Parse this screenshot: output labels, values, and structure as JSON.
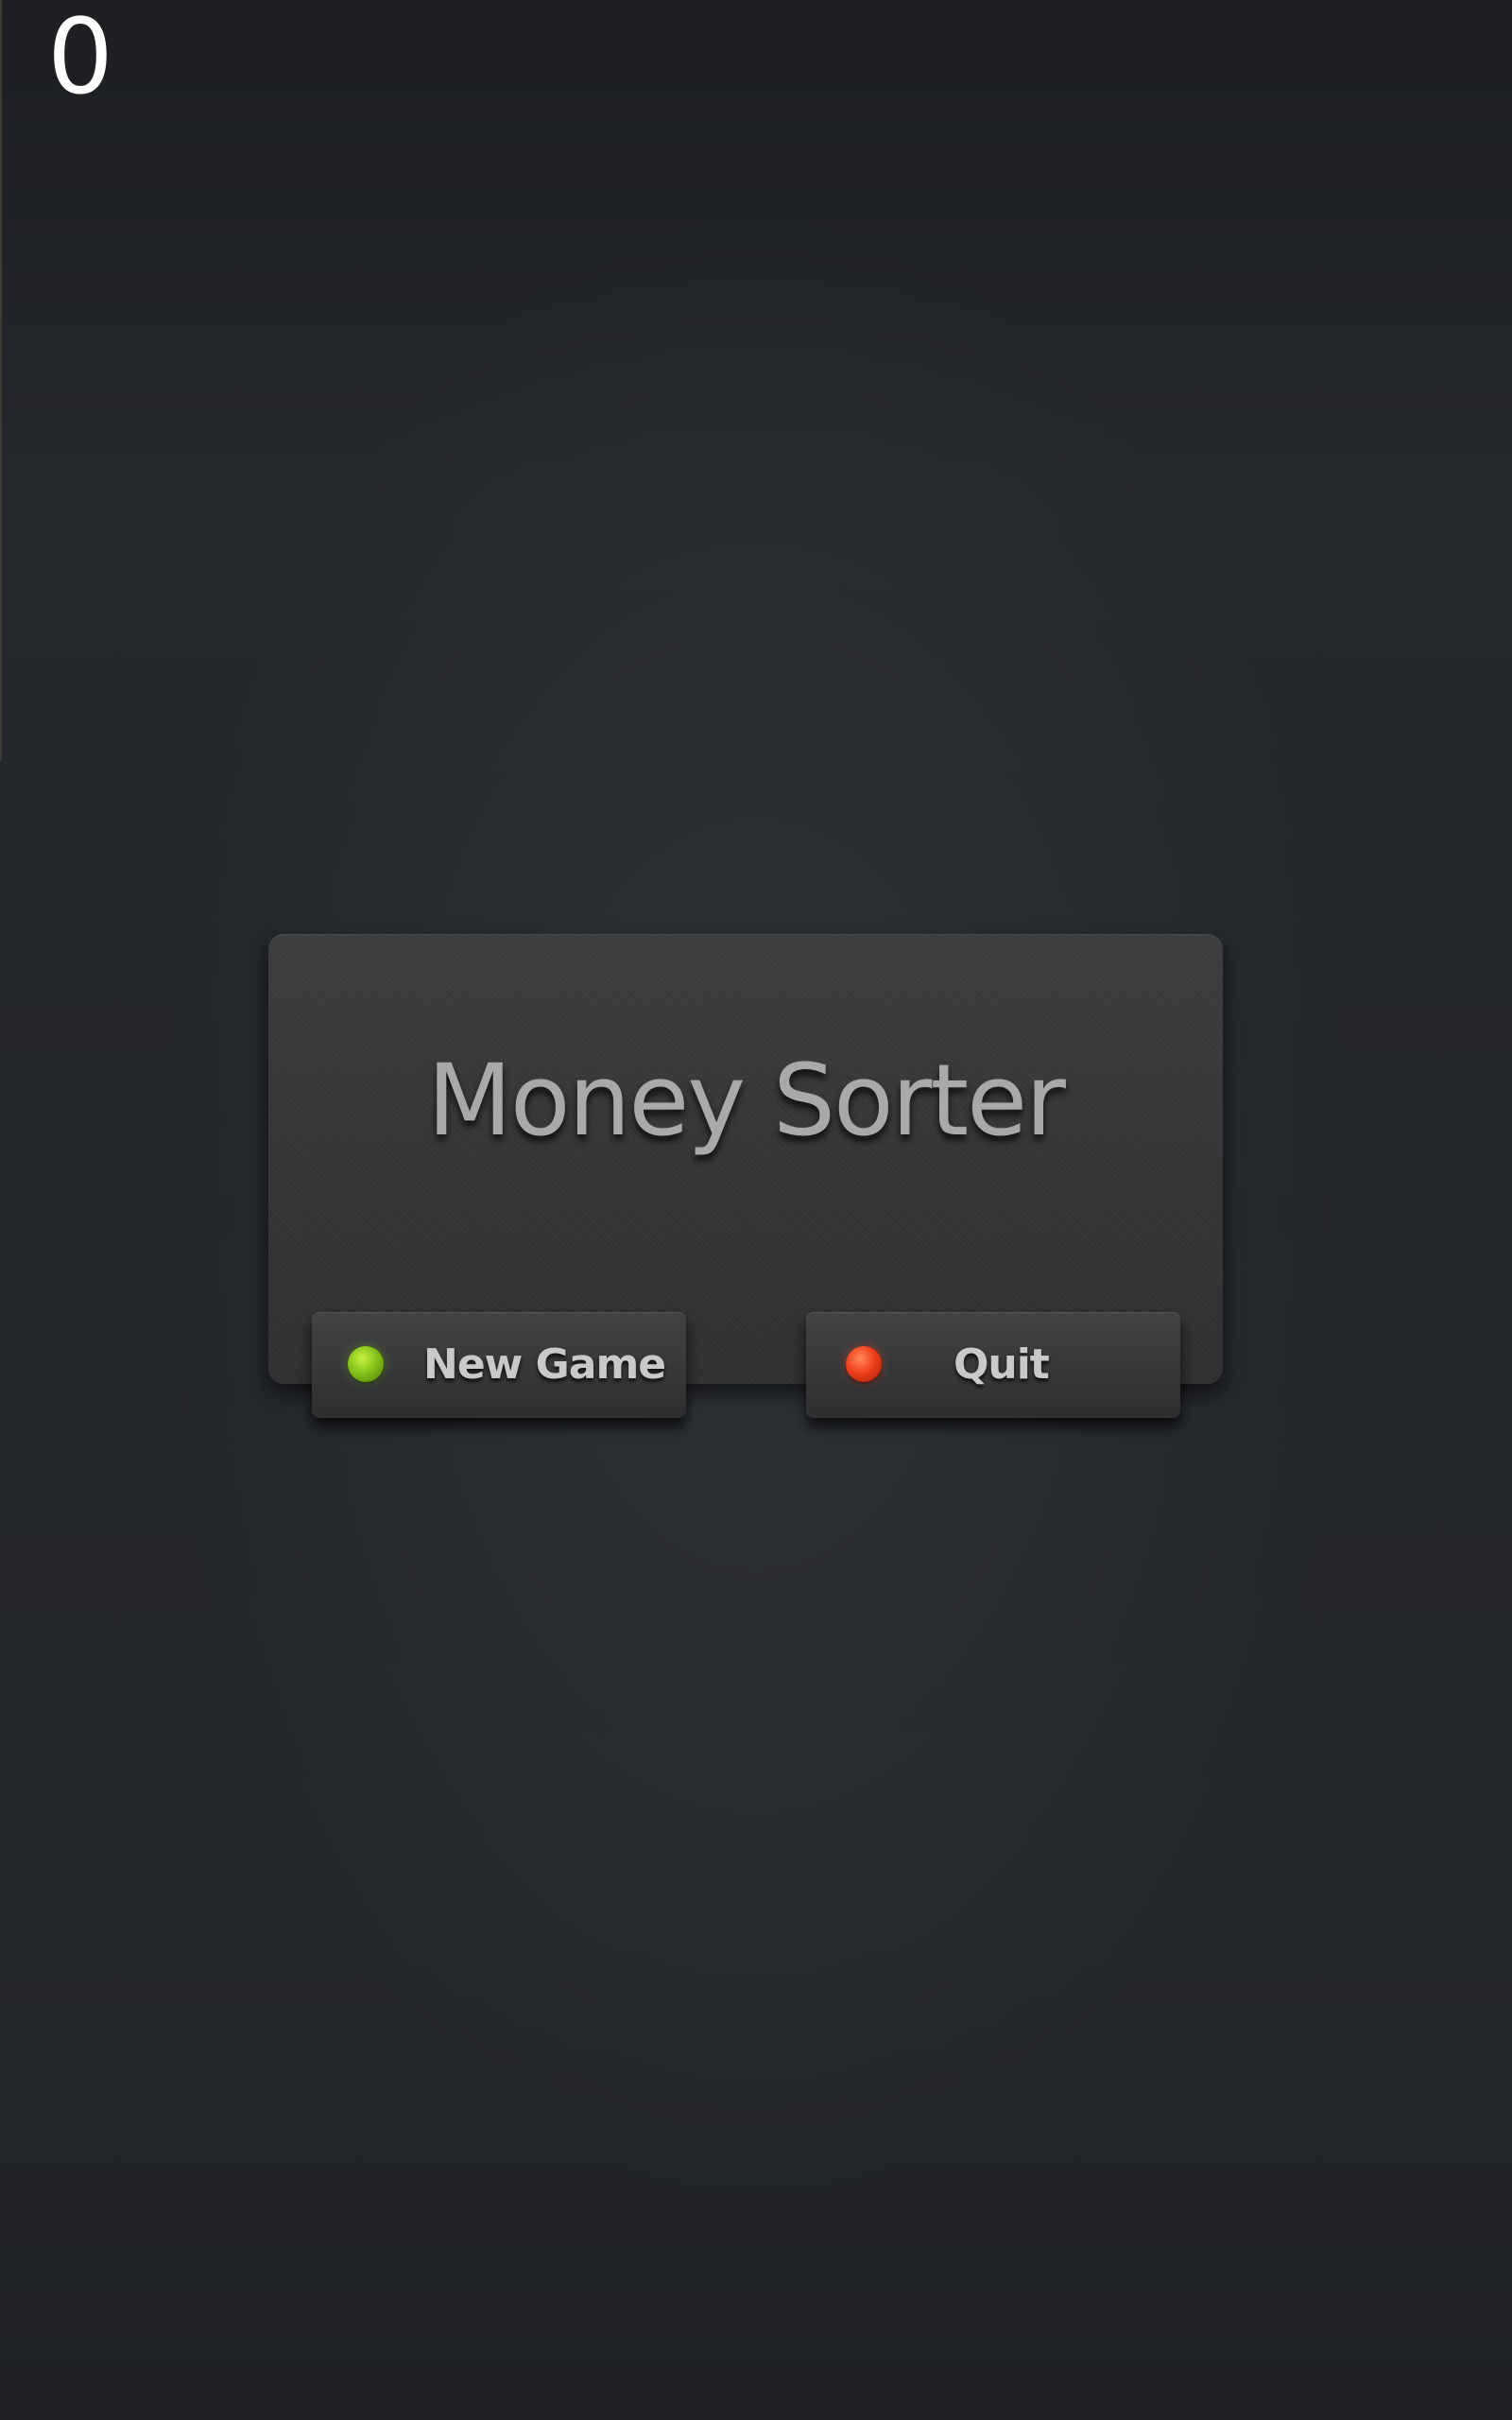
{
  "hud": {
    "score": "0"
  },
  "menu": {
    "title": "Money Sorter",
    "buttons": {
      "new_game": {
        "label": "New Game",
        "indicator_color": "#86c41a"
      },
      "quit": {
        "label": "Quit",
        "indicator_color": "#f0401c"
      }
    }
  }
}
